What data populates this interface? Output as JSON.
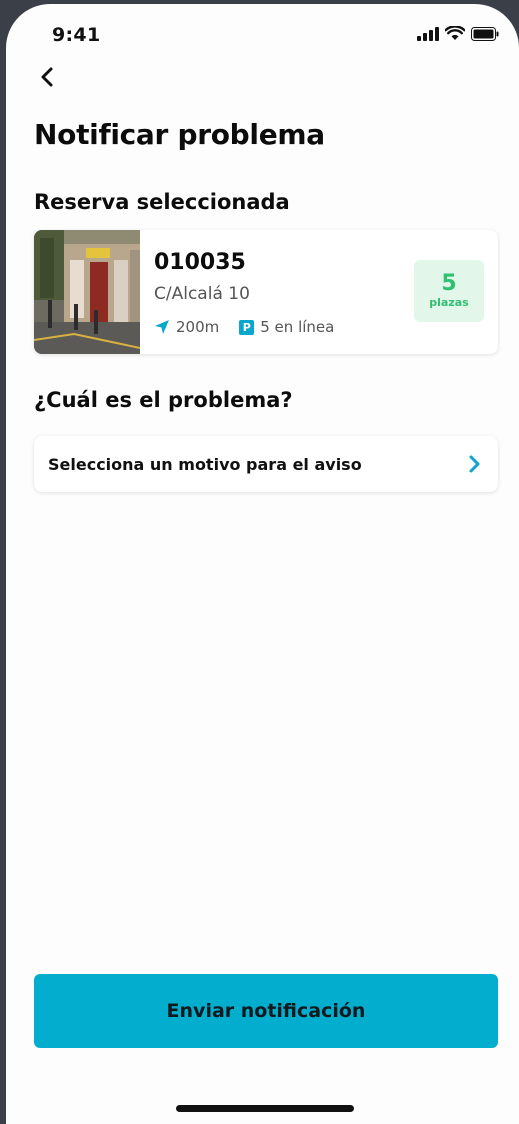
{
  "status_bar": {
    "time": "9:41",
    "icons": [
      "signal-icon",
      "wifi-icon",
      "battery-icon"
    ]
  },
  "header": {
    "back_icon": "chevron-left-icon",
    "title": "Notificar problema"
  },
  "reservation": {
    "section_title": "Reserva seleccionada",
    "code": "010035",
    "address": "C/Alcalá 10",
    "distance": "200m",
    "parking_status": "5 en línea",
    "parking_icon_letter": "P",
    "spots_count": "5",
    "spots_label": "plazas"
  },
  "problem": {
    "section_title": "¿Cuál es el problema?",
    "select_label": "Selecciona un motivo para el aviso",
    "chevron_icon": "chevron-right-icon"
  },
  "footer": {
    "submit_label": "Enviar notificación"
  },
  "colors": {
    "accent": "#03adce",
    "badge_bg": "#e2f6ea",
    "badge_text": "#2fc071",
    "background": "#fdfdfd",
    "frame": "#3b3f48"
  }
}
